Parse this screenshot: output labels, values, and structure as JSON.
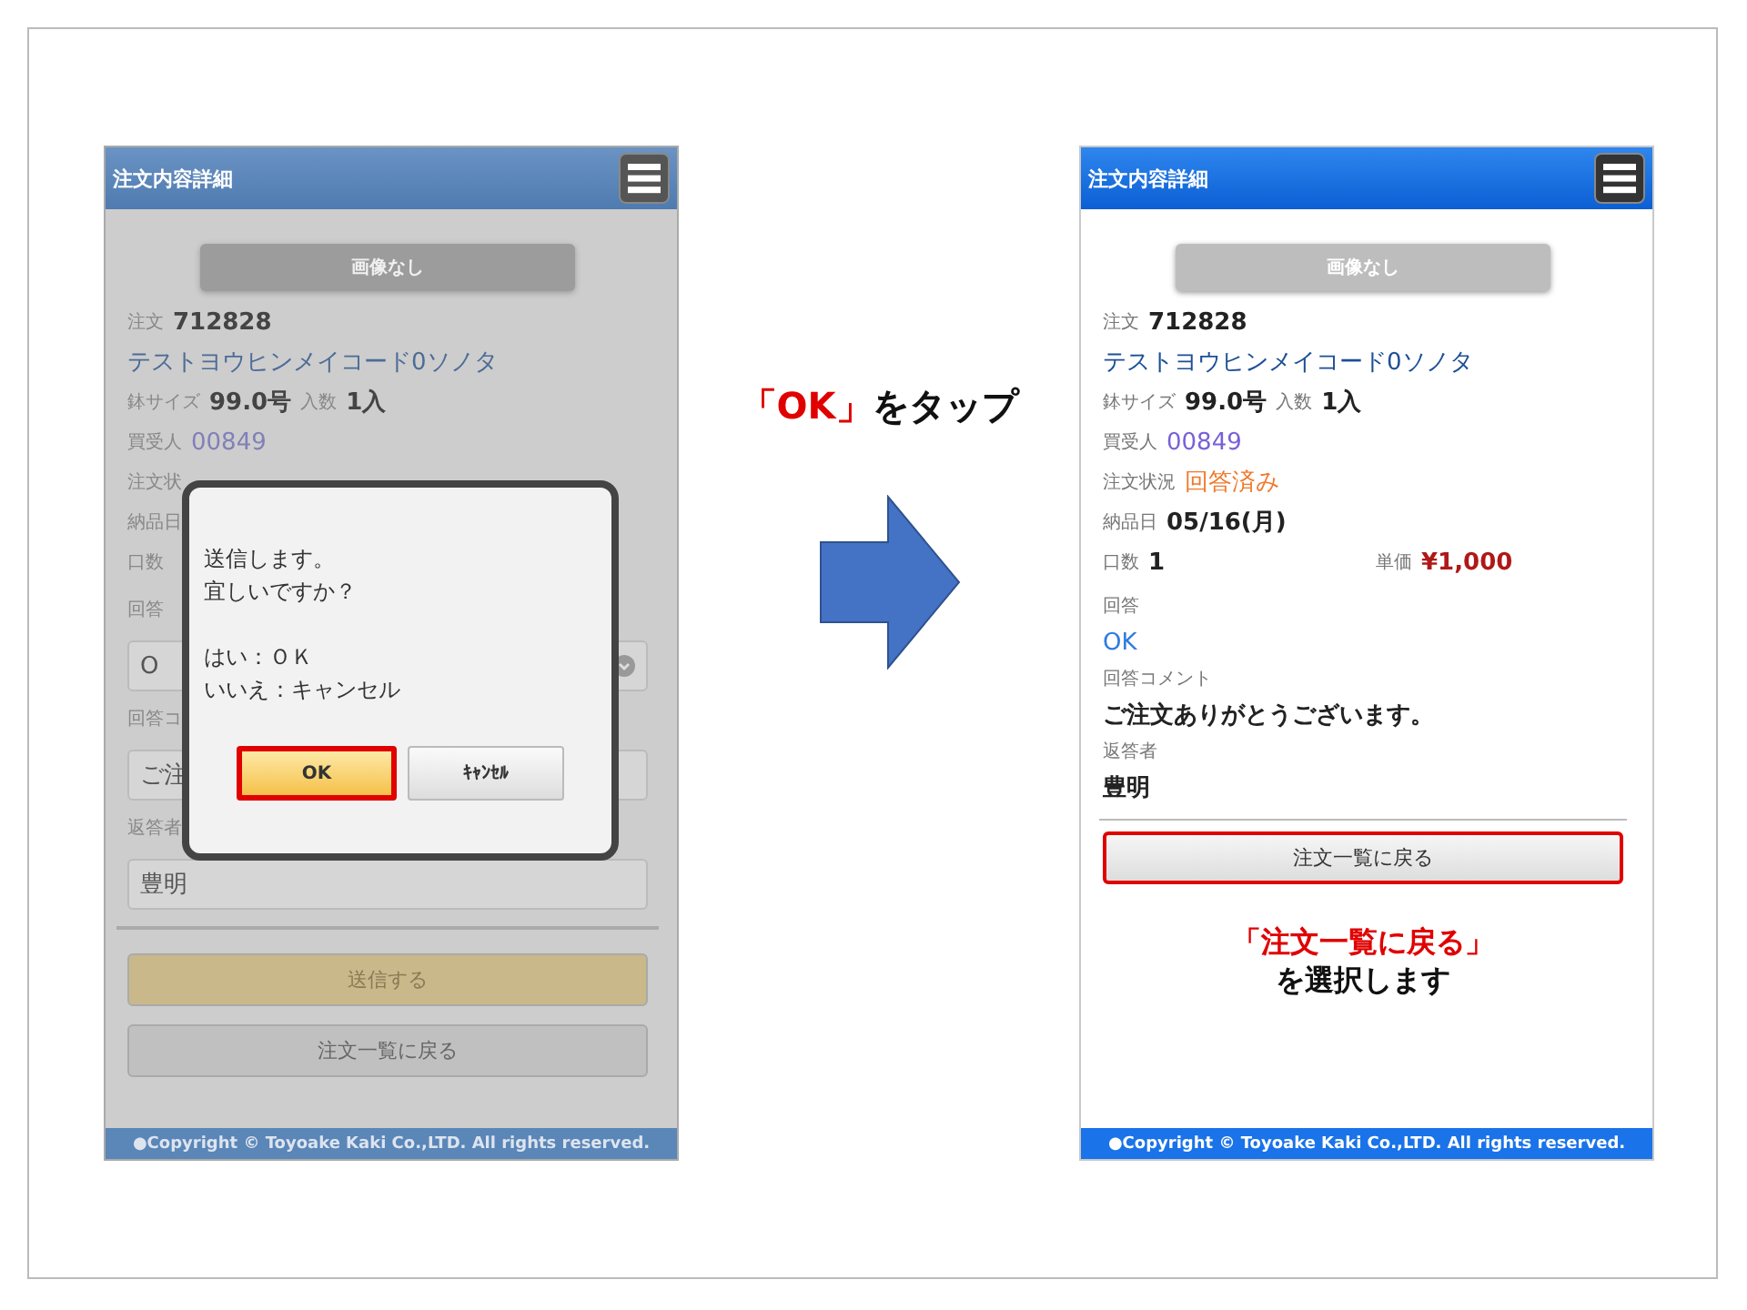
{
  "left_phone": {
    "dimmed": true,
    "title": "注文内容詳細",
    "image_label": "画像なし",
    "order": {
      "label": "注文",
      "value": "712828"
    },
    "product": "テストヨウヒンメイコード0ソノタ",
    "size": {
      "label": "鉢サイズ",
      "value": "99.0号"
    },
    "quantity": {
      "label": "入数",
      "value": "1入"
    },
    "buyer": {
      "label": "買受人",
      "value": "00849"
    },
    "status_label": "注文状",
    "delivery_label": "納品日",
    "count_label": "口数",
    "answer_label": "回答",
    "answer_select": "O",
    "comment_label": "回答コ",
    "comment_field": "ご注",
    "responder_label": "返答者",
    "responder_field": "豊明",
    "send_button": "送信する",
    "back_button": {
      "label": "注文一覧に戻る",
      "highlighted": false
    },
    "footer": "●Copyright © Toyoake Kaki Co.,LTD. All rights reserved.",
    "dialog": {
      "message_groups": [
        [
          "送信します。",
          "宜しいですか？"
        ],
        [
          "はい：ＯＫ",
          "いいえ：キャンセル"
        ]
      ],
      "buttons": [
        {
          "label": "OK",
          "kind": "primary",
          "highlighted": true
        },
        {
          "label": "ｷｬﾝｾﾙ",
          "kind": "secondary",
          "highlighted": false
        }
      ]
    }
  },
  "tap_caption": {
    "highlight": "「OK」",
    "text": "をタップ"
  },
  "right_phone": {
    "dimmed": false,
    "title": "注文内容詳細",
    "image_label": "画像なし",
    "order": {
      "label": "注文",
      "value": "712828"
    },
    "product": "テストヨウヒンメイコード0ソノタ",
    "size": {
      "label": "鉢サイズ",
      "value": "99.0号"
    },
    "quantity": {
      "label": "入数",
      "value": "1入"
    },
    "buyer": {
      "label": "買受人",
      "value": "00849"
    },
    "status": {
      "label": "注文状況",
      "value": "回答済み"
    },
    "delivery": {
      "label": "納品日",
      "value": "05/16(月)"
    },
    "count": {
      "label": "口数",
      "value": "1"
    },
    "unit_price": {
      "label": "単価",
      "value": "¥1,000"
    },
    "answer": {
      "label": "回答",
      "value": "OK"
    },
    "comment": {
      "label": "回答コメント",
      "value": "ご注文ありがとうございます。"
    },
    "responder": {
      "label": "返答者",
      "value": "豊明"
    },
    "back_button": {
      "label": "注文一覧に戻る",
      "highlighted": true
    },
    "instruction": {
      "highlight": "「注文一覧に戻る」",
      "text": "を選択します"
    },
    "footer": "●Copyright © Toyoake Kaki Co.,LTD. All rights reserved."
  }
}
